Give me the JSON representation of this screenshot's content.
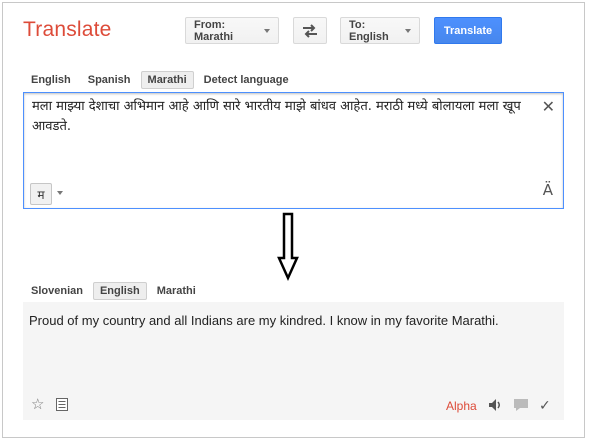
{
  "header": {
    "logo": "Translate",
    "from_label": "From: Marathi",
    "to_label": "To: English",
    "translate_label": "Translate"
  },
  "source": {
    "languages": [
      "English",
      "Spanish",
      "Marathi",
      "Detect language"
    ],
    "active_language": "Marathi",
    "text": "मला माझ्या देशाचा अभिमान आहे आणि सारे भारतीय माझे बांधव आहेत. मराठी मध्ये बोलायला मला खूप आवडते.",
    "ime_char": "म",
    "clear_symbol": "✕",
    "accent_symbol": "Ä"
  },
  "target": {
    "languages": [
      "Slovenian",
      "English",
      "Marathi"
    ],
    "active_language": "English",
    "text": "Proud of my country and all Indians are my kindred. I know in my favorite Marathi.",
    "alpha_label": "Alpha"
  },
  "colors": {
    "brand_red": "#dd4b39",
    "accent_blue": "#4d90fe"
  },
  "icons": {
    "swap": "swap-icon",
    "star": "star-icon",
    "list": "list-icon",
    "speaker": "speaker-icon",
    "bubble": "speech-bubble-icon",
    "check": "check-icon"
  }
}
